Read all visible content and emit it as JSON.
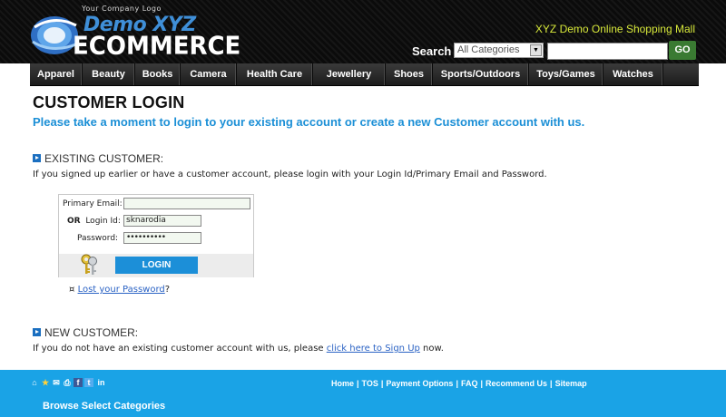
{
  "header": {
    "logo_tagline": "Your Company Logo",
    "logo_line1": "Demo XYZ",
    "logo_line2": "ECOMMERCE",
    "mall_title": "XYZ Demo Online Shopping Mall",
    "search_label": "Search",
    "search_category": "All Categories",
    "search_value": "",
    "go_label": "GO"
  },
  "nav": {
    "items": [
      "Apparel",
      "Beauty",
      "Books",
      "Camera",
      "Health Care",
      "Jewellery",
      "Shoes",
      "Sports/Outdoors",
      "Toys/Games",
      "Watches"
    ]
  },
  "main": {
    "title": "CUSTOMER LOGIN",
    "subtitle": "Please take a moment to login to your existing account or create a new Customer account with us.",
    "existing": {
      "heading": "EXISTING CUSTOMER:",
      "text": "If you signed up earlier or have a customer account, please login with your Login Id/Primary Email and Password."
    },
    "form": {
      "email_label": "Primary Email:",
      "email_value": "",
      "or_label": "OR",
      "loginid_label": "Login Id:",
      "loginid_value": "sknarodia",
      "password_label": "Password:",
      "password_value": "••••••••••",
      "login_button": "LOGIN"
    },
    "lost": {
      "bullet": "¤",
      "link": "Lost your Password",
      "suffix": "?"
    },
    "new": {
      "heading": "NEW CUSTOMER:",
      "text_before": "If you do not have an existing customer account with us, please ",
      "link": "click here to Sign Up",
      "text_after": " now."
    }
  },
  "footer": {
    "icons": [
      "home-icon",
      "star-icon",
      "mail-icon",
      "print-icon",
      "facebook-icon",
      "twitter-icon",
      "linkedin-icon"
    ],
    "links": [
      "Home",
      "TOS",
      "Payment Options",
      "FAQ",
      "Recommend Us",
      "Sitemap"
    ],
    "separator": "|",
    "browse": "Browse Select Categories"
  },
  "colors": {
    "accent_blue": "#1b8fd6",
    "footer_blue": "#1aa3e6",
    "mall_yellow": "#d7e83a",
    "go_green": "#3a7a32"
  }
}
